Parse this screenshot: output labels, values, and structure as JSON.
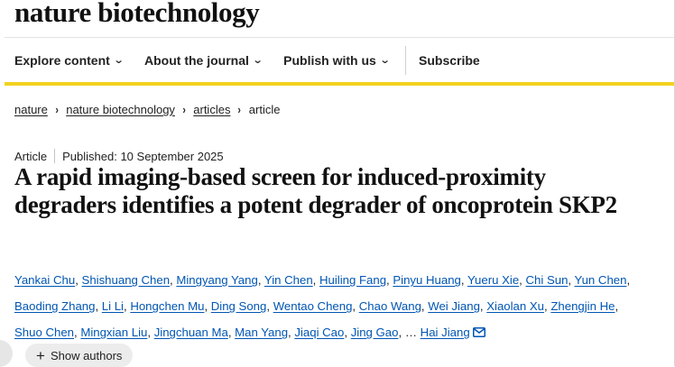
{
  "site": {
    "logo": "nature biotechnology"
  },
  "nav": {
    "items": [
      {
        "label": "Explore content",
        "chevron": "chevron-down-icon"
      },
      {
        "label": "About the journal",
        "chevron": "chevron-down-icon"
      },
      {
        "label": "Publish with us",
        "chevron": "chevron-down-icon"
      }
    ],
    "subscribe": "Subscribe"
  },
  "breadcrumb": {
    "items": [
      "nature",
      "nature biotechnology",
      "articles"
    ],
    "current": "article",
    "separator": "›"
  },
  "article": {
    "type": "Article",
    "published": "Published: 10 September 2025",
    "title": "A rapid imaging-based screen for induced-proximity degraders identifies a potent degrader of oncoprotein SKP2",
    "authors": [
      "Yankai Chu",
      "Shishuang Chen",
      "Mingyang Yang",
      "Yin Chen",
      "Huiling Fang",
      "Pinyu Huang",
      "Yueru Xie",
      "Chi Sun",
      "Yun Chen",
      "Baoding Zhang",
      "Li Li",
      "Hongchen Mu",
      "Ding Song",
      "Wentao Cheng",
      "Chao Wang",
      "Wei Jiang",
      "Xiaolan Xu",
      "Zhengjin He",
      "Shuo Chen",
      "Mingxian Liu",
      "Jingchuan Ma",
      "Man Yang",
      "Jiaqi Cao",
      "Jing Gao"
    ],
    "ellipsis": "…",
    "last_author": "Hai Jiang",
    "show_authors": "Show authors"
  },
  "colors": {
    "accent_rule": "#f2d21f",
    "author_link": "#0056b3",
    "text": "#222222"
  }
}
